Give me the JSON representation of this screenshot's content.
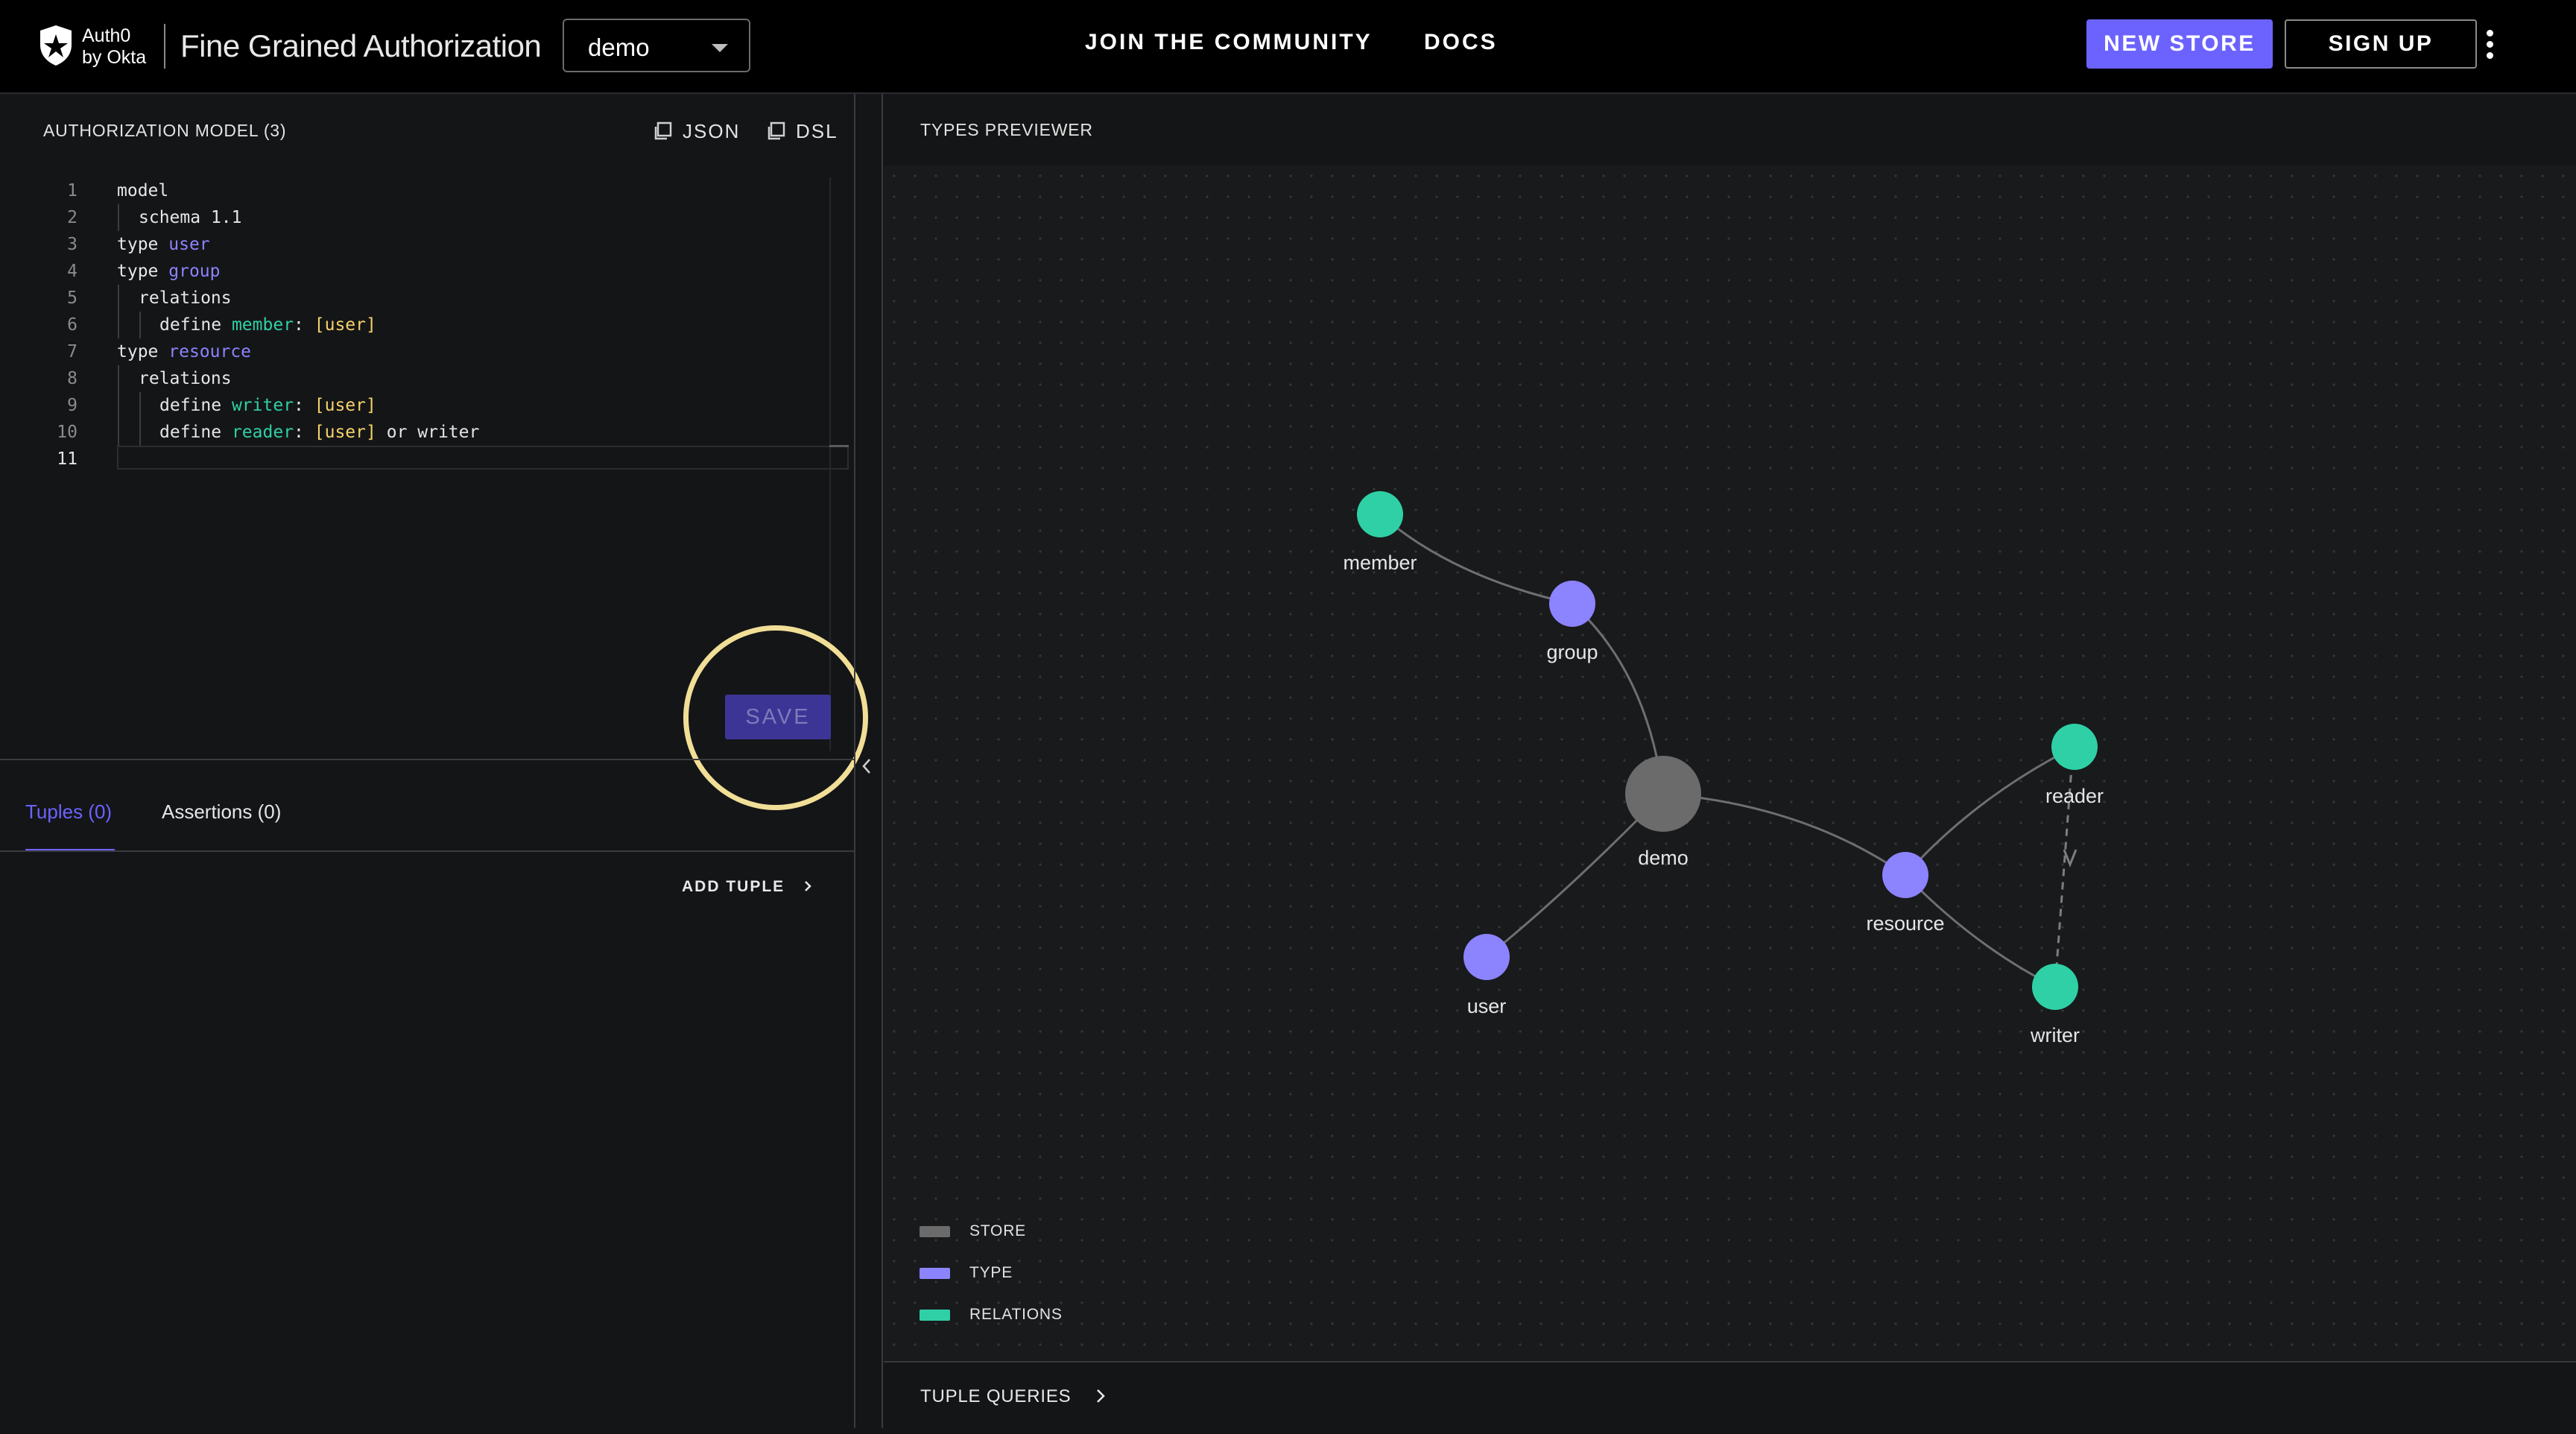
{
  "header": {
    "brand_line1": "Auth0",
    "brand_line2": "by Okta",
    "product": "Fine Grained Authorization",
    "store_select": "demo",
    "nav": [
      "JOIN  THE COMMUNITY",
      "DOCS"
    ],
    "new_store": "NEW STORE",
    "sign_up": "SIGN UP"
  },
  "model_pane": {
    "title": "AUTHORIZATION MODEL (3)",
    "json_label": "JSON",
    "dsl_label": "DSL",
    "line_numbers": [
      "1",
      "2",
      "3",
      "4",
      "5",
      "6",
      "7",
      "8",
      "9",
      "10",
      "11"
    ],
    "code": {
      "l1": "model",
      "l2_kw": "schema",
      "l2_val": "1.1",
      "l3_kw": "type",
      "l3_name": "user",
      "l4_kw": "type",
      "l4_name": "group",
      "l5": "relations",
      "l6_kw": "define",
      "l6_rel": "member",
      "l6_colon": ":",
      "l6_type": "[user]",
      "l7_kw": "type",
      "l7_name": "resource",
      "l8": "relations",
      "l9_kw": "define",
      "l9_rel": "writer",
      "l9_colon": ":",
      "l9_type": "[user]",
      "l10_kw": "define",
      "l10_rel": "reader",
      "l10_colon": ":",
      "l10_type": "[user]",
      "l10_rest": "or writer"
    },
    "save": "SAVE"
  },
  "tuples_pane": {
    "tabs": [
      "Tuples (0)",
      "Assertions (0)"
    ],
    "add_tuple": "ADD TUPLE"
  },
  "preview": {
    "title": "TYPES PREVIEWER",
    "nodes": {
      "member": "member",
      "group": "group",
      "demo": "demo",
      "user": "user",
      "resource": "resource",
      "reader": "reader",
      "writer": "writer"
    },
    "legend": [
      {
        "label": "STORE",
        "color": "#6b6b6b"
      },
      {
        "label": "TYPE",
        "color": "#8c83ff"
      },
      {
        "label": "RELATIONS",
        "color": "#2fd0a5"
      }
    ],
    "tuple_queries": "TUPLE QUERIES"
  },
  "colors": {
    "accent": "#6c63ff",
    "type_node": "#8c83ff",
    "relation_node": "#2fd0a5",
    "store_node": "#6b6b6b",
    "highlight": "#f1de97"
  }
}
